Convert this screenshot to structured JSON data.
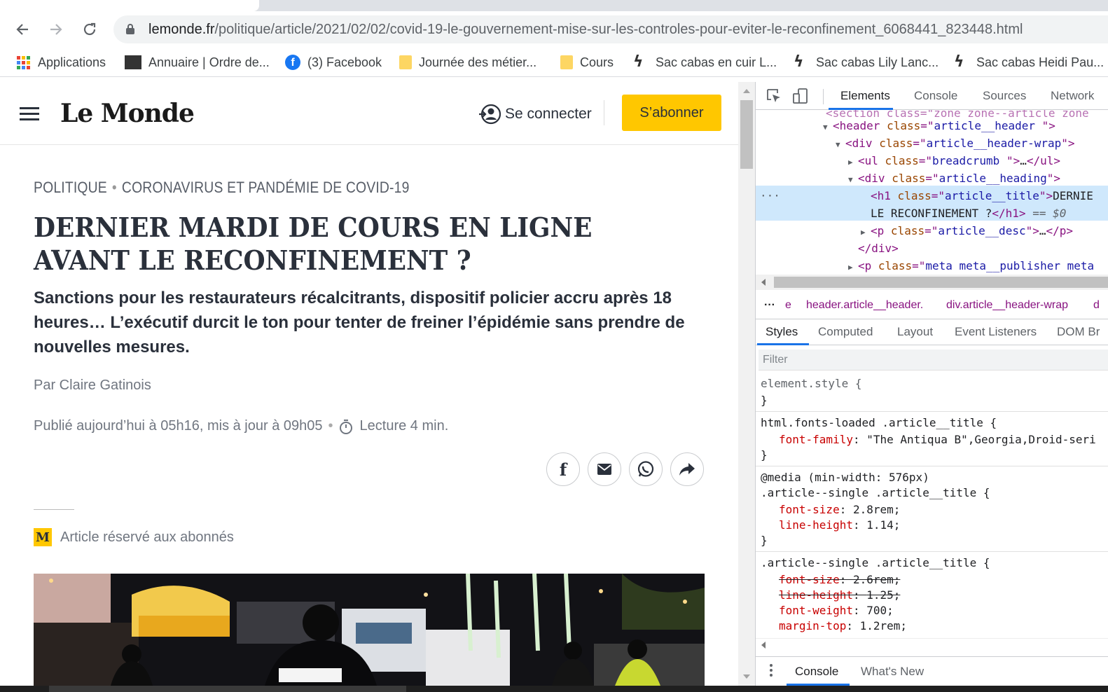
{
  "browser": {
    "url_host": "lemonde.fr",
    "url_path": "/politique/article/2021/02/02/covid-19-le-gouvernement-mise-sur-les-controles-pour-eviter-le-reconfinement_6068441_823448.html",
    "bookmarks": [
      {
        "label": "Applications",
        "icon": "apps-grid-icon"
      },
      {
        "label": "Annuaire | Ordre de...",
        "icon": "site-favicon"
      },
      {
        "label": "(3) Facebook",
        "icon": "facebook-icon"
      },
      {
        "label": "Journée des métier...",
        "icon": "folder-icon"
      },
      {
        "label": "Cours",
        "icon": "folder-icon"
      },
      {
        "label": "Sac cabas en cuir L...",
        "icon": "lily-favicon"
      },
      {
        "label": "Sac cabas Lily Lanc...",
        "icon": "lily-favicon"
      },
      {
        "label": "Sac cabas Heidi Pau...",
        "icon": "lily-favicon"
      }
    ]
  },
  "site": {
    "logo": "Le Monde",
    "login_label": "Se connecter",
    "subscribe_label": "S’abonner",
    "subscribe_color": "#ffc700"
  },
  "article": {
    "breadcrumb": [
      "POLITIQUE",
      "CORONAVIRUS ET PANDÉMIE DE COVID-19"
    ],
    "breadcrumb_sep": "•",
    "title": "DERNIER MARDI DE COURS EN LIGNE AVANT LE RECONFINEMENT ?",
    "description": "Sanctions pour les restaurateurs récalcitrants, dispositif policier accru après 18 heures… L’exécutif durcit le ton pour tenter de freiner l’épidémie sans prendre de nouvelles mesures.",
    "author": "Par Claire Gatinois",
    "published": "Publié aujourd’hui à 05h16, mis à jour à 09h05",
    "reading_time": "Lecture 4 min.",
    "premium_badge": "M",
    "premium_label": "Article réservé aux abonnés"
  },
  "devtools": {
    "tabs": [
      "Elements",
      "Console",
      "Sources",
      "Network"
    ],
    "active_tab": "Elements",
    "dom": {
      "l0": "<section class=\"zone zone--article  zone",
      "l1_tag": "header",
      "l1_class": "article__header  ",
      "l2_tag": "div",
      "l2_class": "article__header-wrap",
      "l3_tag": "ul",
      "l3_class": "breadcrumb ",
      "l4_tag": "div",
      "l4_class": "article__heading",
      "l5_tag": "h1",
      "l5_class": "article__title",
      "l5_text_a": "DERNIE",
      "l5_text_b": "LE RECONFINEMENT ?",
      "l5_eq": "== $0",
      "l6_tag": "p",
      "l6_class": "article__desc",
      "l7": "</div>",
      "l8_tag": "p",
      "l8_class": "meta meta__publisher meta",
      "ellipsis": "…"
    },
    "crumbs": [
      "e",
      "header.article__header.",
      "div.article__header-wrap",
      "d"
    ],
    "styles_tabs": [
      "Styles",
      "Computed",
      "Layout",
      "Event Listeners",
      "DOM Br"
    ],
    "filter_placeholder": "Filter",
    "rules": {
      "r1_selector": "element.style {",
      "r2_selector": "html.fonts-loaded .article__title {",
      "r2_prop": "font-family",
      "r2_val": "\"The Antiqua B\",Georgia,Droid-seri",
      "r3_media": "@media (min-width: 576px)",
      "r3_selector": ".article--single .article__title {",
      "r3_p1": "font-size",
      "r3_v1": "2.8rem;",
      "r3_p2": "line-height",
      "r3_v2": "1.14;",
      "r4_selector": ".article--single .article__title {",
      "r4_p1": "font-size",
      "r4_v1": "2.6rem;",
      "r4_p2": "line-height",
      "r4_v2": "1.25;",
      "r4_p3": "font-weight",
      "r4_v3": "700;",
      "r4_p4": "margin-top",
      "r4_v4": "1.2rem;",
      "close": "}"
    },
    "drawer_tabs": [
      "Console",
      "What's New"
    ]
  }
}
